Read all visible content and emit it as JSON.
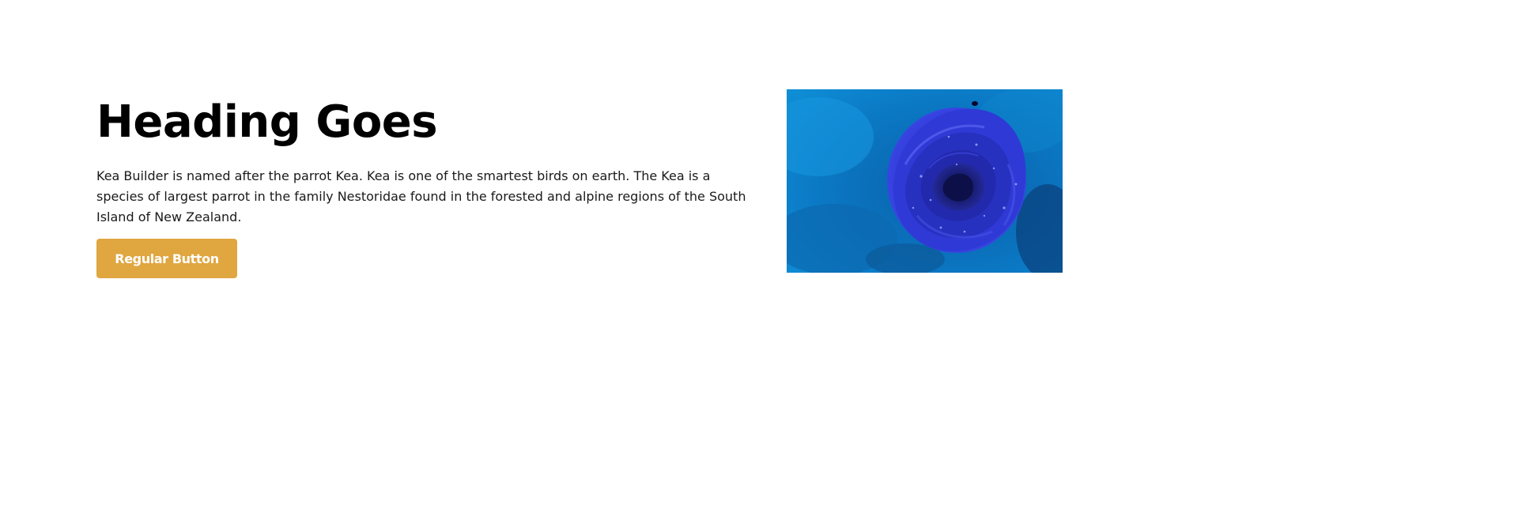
{
  "content": {
    "heading": "Heading Goes",
    "paragraph": "Kea Builder is named after the parrot Kea. Kea is one of the smartest birds on earth. The Kea is a species of largest parrot in the family Nestoridae found in the forested and alpine regions of the South Island of New Zealand.",
    "button_label": "Regular Button"
  },
  "image": {
    "subject": "blue-rose-photo"
  },
  "colors": {
    "button_bg": "#e0a640",
    "button_text": "#ffffff",
    "heading": "#000000",
    "body_text": "#1a1a1a"
  }
}
